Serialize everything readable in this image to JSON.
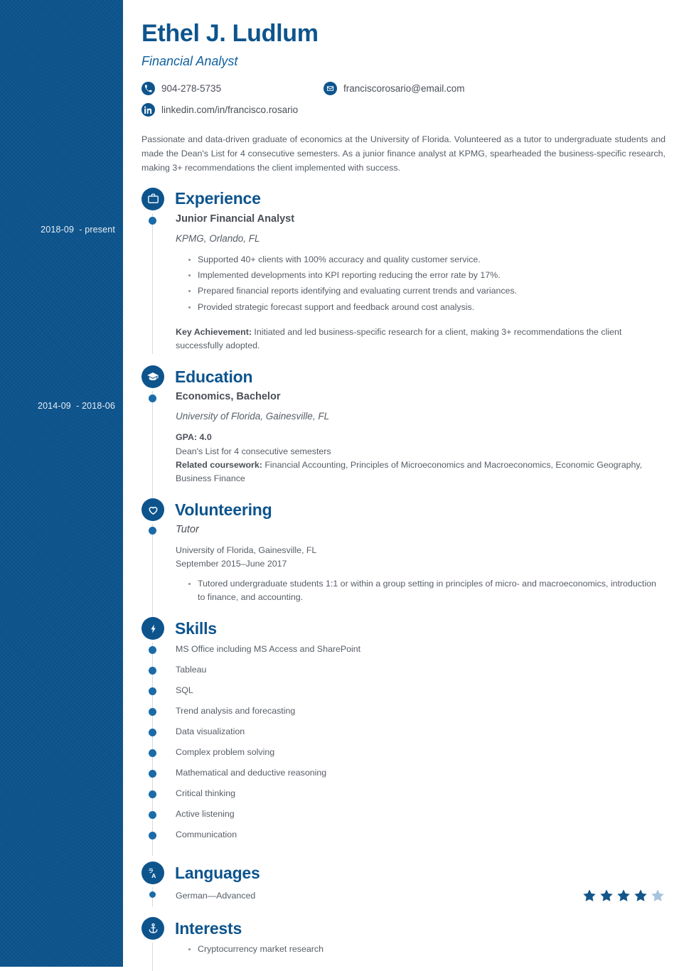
{
  "colors": {
    "sidebar_bg": "#0d548d",
    "accent": "#0d548d",
    "heading": "#0d548d",
    "body_text": "#575d66",
    "star_filled": "#135689",
    "star_empty": "#a8c4dc"
  },
  "header": {
    "name": "Ethel J. Ludlum",
    "job_title": "Financial Analyst",
    "contacts": {
      "phone": "904-278-5735",
      "phone_icon": "phone-icon",
      "email": "franciscorosario@email.com",
      "email_icon": "envelope-icon",
      "linkedin": "linkedin.com/in/francisco.rosario",
      "linkedin_icon": "linkedin-icon"
    }
  },
  "summary": "Passionate and data-driven graduate of economics at the University of Florida. Volunteered as a tutor to undergraduate students and made the Dean's List for 4 consecutive semesters. As a junior finance analyst at KPMG, spearheaded the business-specific research, making 3+ recommendations the client implemented with success.",
  "sidebar_dates": {
    "experience": "2018-09  - present",
    "education": "2014-09  - 2018-06"
  },
  "sections": {
    "experience": {
      "title": "Experience",
      "icon": "briefcase-icon",
      "entry": {
        "role": "Junior Financial Analyst",
        "company": "KPMG, Orlando, FL",
        "bullets": [
          "Supported 40+ clients with 100% accuracy and quality customer service.",
          "Implemented developments into KPI reporting reducing the error rate by 17%.",
          "Prepared financial reports identifying and evaluating current trends and variances.",
          "Provided strategic forecast support and feedback around cost analysis."
        ],
        "key_achievement_label": "Key Achievement:",
        "key_achievement_text": " Initiated and led business-specific research for a client, making 3+ recommendations the client successfully adopted."
      }
    },
    "education": {
      "title": "Education",
      "icon": "graduation-cap-icon",
      "entry": {
        "degree": "Economics, Bachelor",
        "school": "University of Florida, Gainesville, FL",
        "gpa": "GPA: 4.0",
        "honors": "Dean's List for 4 consecutive semesters",
        "coursework_label": "Related coursework:",
        "coursework_text": " Financial Accounting, Principles of Microeconomics and Macroeconomics, Economic Geography, Business Finance"
      }
    },
    "volunteering": {
      "title": "Volunteering",
      "icon": "heart-icon",
      "entry": {
        "role": "Tutor",
        "place": "University of Florida, Gainesville, FL",
        "dates": "September 2015–June 2017",
        "bullets": [
          "Tutored undergraduate students 1:1 or within a group setting in principles of micro- and macroeconomics, introduction to finance, and accounting."
        ]
      }
    },
    "skills": {
      "title": "Skills",
      "icon": "lightning-bolt-icon",
      "items": [
        "MS Office including MS Access and SharePoint",
        "Tableau",
        "SQL",
        "Trend analysis and forecasting",
        "Data visualization",
        "Complex problem solving",
        "Mathematical and deductive reasoning",
        "Critical thinking",
        "Active listening",
        "Communication"
      ]
    },
    "languages": {
      "title": "Languages",
      "icon": "translate-icon",
      "items": [
        {
          "label": "German—Advanced",
          "rating": 4,
          "max_rating": 5
        }
      ]
    },
    "interests": {
      "title": "Interests",
      "icon": "anchor-icon",
      "items": [
        "Cryptocurrency market research"
      ]
    }
  }
}
